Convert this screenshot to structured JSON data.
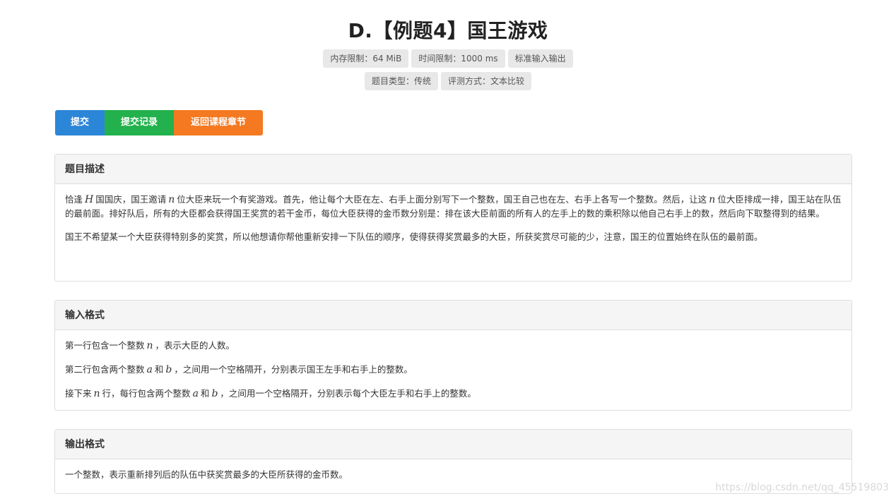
{
  "problem": {
    "title": "D.【例题4】国王游戏",
    "tags_row1": [
      "内存限制：64 MiB",
      "时间限制：1000 ms",
      "标准输入输出"
    ],
    "tags_row2": [
      "题目类型：传统",
      "评测方式：文本比较"
    ]
  },
  "actions": {
    "submit": "提交",
    "records": "提交记录",
    "back": "返回课程章节"
  },
  "description": {
    "heading": "题目描述",
    "p1_a": "恰逢",
    "p1_var_h": "H",
    "p1_b": "国国庆，国王邀请",
    "p1_var_n1": "n",
    "p1_c": "位大臣来玩一个有奖游戏。首先，他让每个大臣在左、右手上面分别写下一个整数，国王自己也在左、右手上各写一个整数。然后，让这",
    "p1_var_n2": "n",
    "p1_d": "位大臣排成一排，国王站在队伍的最前面。排好队后，所有的大臣都会获得国王奖赏的若干金币，每位大臣获得的金币数分别是：排在该大臣前面的所有人的左手上的数的乘积除以他自己右手上的数，然后向下取整得到的结果。",
    "p2": "国王不希望某一个大臣获得特别多的奖赏，所以他想请你帮他重新安排一下队伍的顺序，使得获得奖赏最多的大臣，所获奖赏尽可能的少，注意，国王的位置始终在队伍的最前面。"
  },
  "input": {
    "heading": "输入格式",
    "l1_a": "第一行包含一个整数",
    "l1_var": "n",
    "l1_b": "，表示大臣的人数。",
    "l2_a": "第二行包含两个整数",
    "l2_var_a": "a",
    "l2_and": "和",
    "l2_var_b": "b",
    "l2_b": "，之间用一个空格隔开，分别表示国王左手和右手上的整数。",
    "l3_a": "接下来",
    "l3_var_n": "n",
    "l3_b": "行，每行包含两个整数",
    "l3_var_a": "a",
    "l3_and": "和",
    "l3_var_b": "b",
    "l3_c": "，之间用一个空格隔开，分别表示每个大臣左手和右手上的整数。"
  },
  "output": {
    "heading": "输出格式",
    "l1": "一个整数，表示重新排列后的队伍中获奖赏最多的大臣所获得的金币数。"
  },
  "watermark": "https://blog.csdn.net/qq_45519803"
}
